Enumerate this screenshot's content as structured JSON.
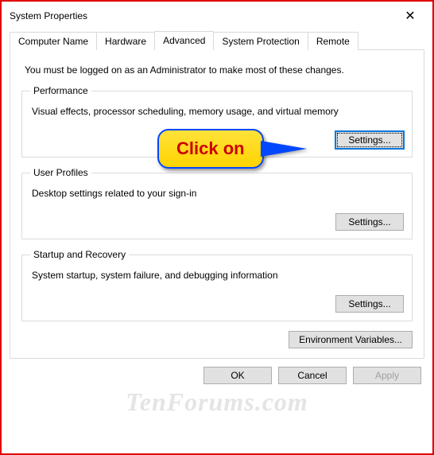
{
  "window": {
    "title": "System Properties",
    "close_glyph": "✕"
  },
  "tabs": {
    "computer_name": "Computer Name",
    "hardware": "Hardware",
    "advanced": "Advanced",
    "system_protection": "System Protection",
    "remote": "Remote"
  },
  "advanced": {
    "intro": "You must be logged on as an Administrator to make most of these changes.",
    "performance": {
      "legend": "Performance",
      "desc": "Visual effects, processor scheduling, memory usage, and virtual memory",
      "button": "Settings..."
    },
    "user_profiles": {
      "legend": "User Profiles",
      "desc": "Desktop settings related to your sign-in",
      "button": "Settings..."
    },
    "startup_recovery": {
      "legend": "Startup and Recovery",
      "desc": "System startup, system failure, and debugging information",
      "button": "Settings..."
    },
    "env_button": "Environment Variables..."
  },
  "dialog_buttons": {
    "ok": "OK",
    "cancel": "Cancel",
    "apply": "Apply"
  },
  "callout": {
    "text": "Click on"
  },
  "watermark": "TenForums.com"
}
